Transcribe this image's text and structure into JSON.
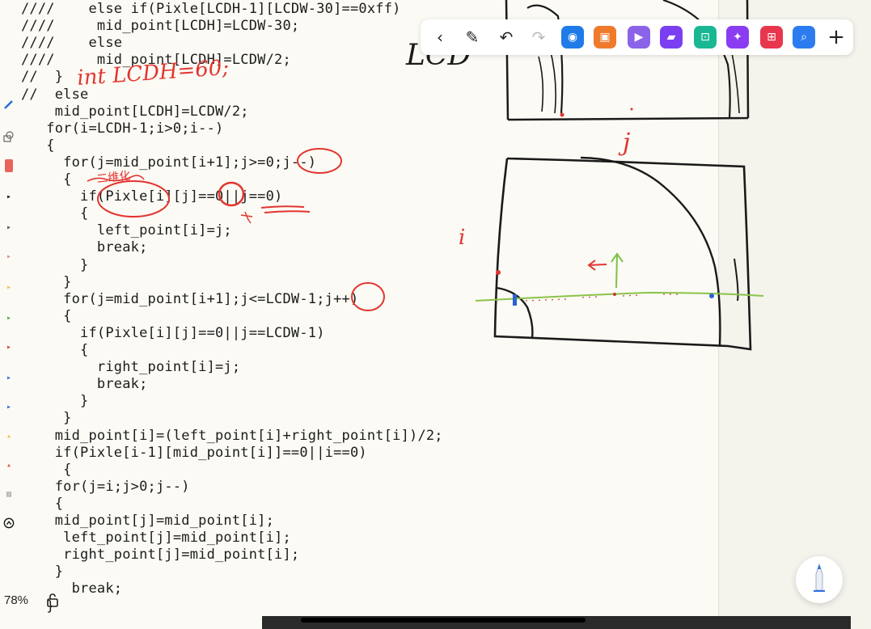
{
  "toolbar": {
    "items": [
      {
        "name": "back-arrow-icon",
        "glyph": "‹",
        "kind": "plain"
      },
      {
        "name": "pen-pin-icon",
        "glyph": "✎",
        "kind": "plain"
      },
      {
        "name": "undo-icon",
        "glyph": "↶",
        "kind": "plain"
      },
      {
        "name": "redo-icon",
        "glyph": "↷",
        "kind": "plain",
        "dim": true
      },
      {
        "name": "camera-icon",
        "glyph": "◉",
        "kind": "app",
        "color": "#1e7be8"
      },
      {
        "name": "image-icon",
        "glyph": "▣",
        "kind": "app",
        "color": "#f07a2c"
      },
      {
        "name": "video-icon",
        "glyph": "▶",
        "kind": "app",
        "color": "#8b63e9"
      },
      {
        "name": "folder-icon",
        "glyph": "▰",
        "kind": "app",
        "color": "#7b3ff2"
      },
      {
        "name": "scan-icon",
        "glyph": "⊡",
        "kind": "app",
        "color": "#19b892"
      },
      {
        "name": "magic-icon",
        "glyph": "✦",
        "kind": "app",
        "color": "#8a3df0"
      },
      {
        "name": "grid-icon",
        "glyph": "⊞",
        "kind": "app",
        "color": "#e8364e"
      },
      {
        "name": "search-icon",
        "glyph": "⌕",
        "kind": "app",
        "color": "#2c7cf0"
      },
      {
        "name": "add-icon",
        "glyph": "+",
        "kind": "plain"
      }
    ]
  },
  "code_lines": [
    "////    else if(Pixle[LCDH-1][LCDW-30]==0xff)",
    "////     mid_point[LCDH]=LCDW-30;",
    "////    else",
    "////     mid_point[LCDH]=LCDW/2;",
    "//  }",
    "//  else",
    "    mid_point[LCDH]=LCDW/2;",
    "   for(i=LCDH-1;i>0;i--)",
    "   {",
    "     for(j=mid_point[i+1];j>=0;j--)",
    "     {",
    "       if(Pixle[i][j]==0||j==0)",
    "       {",
    "         left_point[i]=j;",
    "         break;",
    "       }",
    "     }",
    "     for(j=mid_point[i+1];j<=LCDW-1;j++)",
    "     {",
    "       if(Pixle[i][j]==0||j==LCDW-1)",
    "       {",
    "         right_point[i]=j;",
    "         break;",
    "       }",
    "     }",
    "    mid_point[i]=(left_point[i]+right_point[i])/2;",
    "    if(Pixle[i-1][mid_point[i]]==0||i==0)",
    "     {",
    "    for(j=i;j>0;j--)",
    "    {",
    "    mid_point[j]=mid_point[i];",
    "     left_point[j]=mid_point[i];",
    "     right_point[j]=mid_point[i];",
    "    }",
    "      break;",
    "   }"
  ],
  "annotations": {
    "int_note": "int LCDH=60;",
    "top_right_text": "LCD",
    "j_label": "j",
    "i_label": "i",
    "chinese_note": "二维化"
  },
  "status": {
    "zoom": "78%"
  }
}
